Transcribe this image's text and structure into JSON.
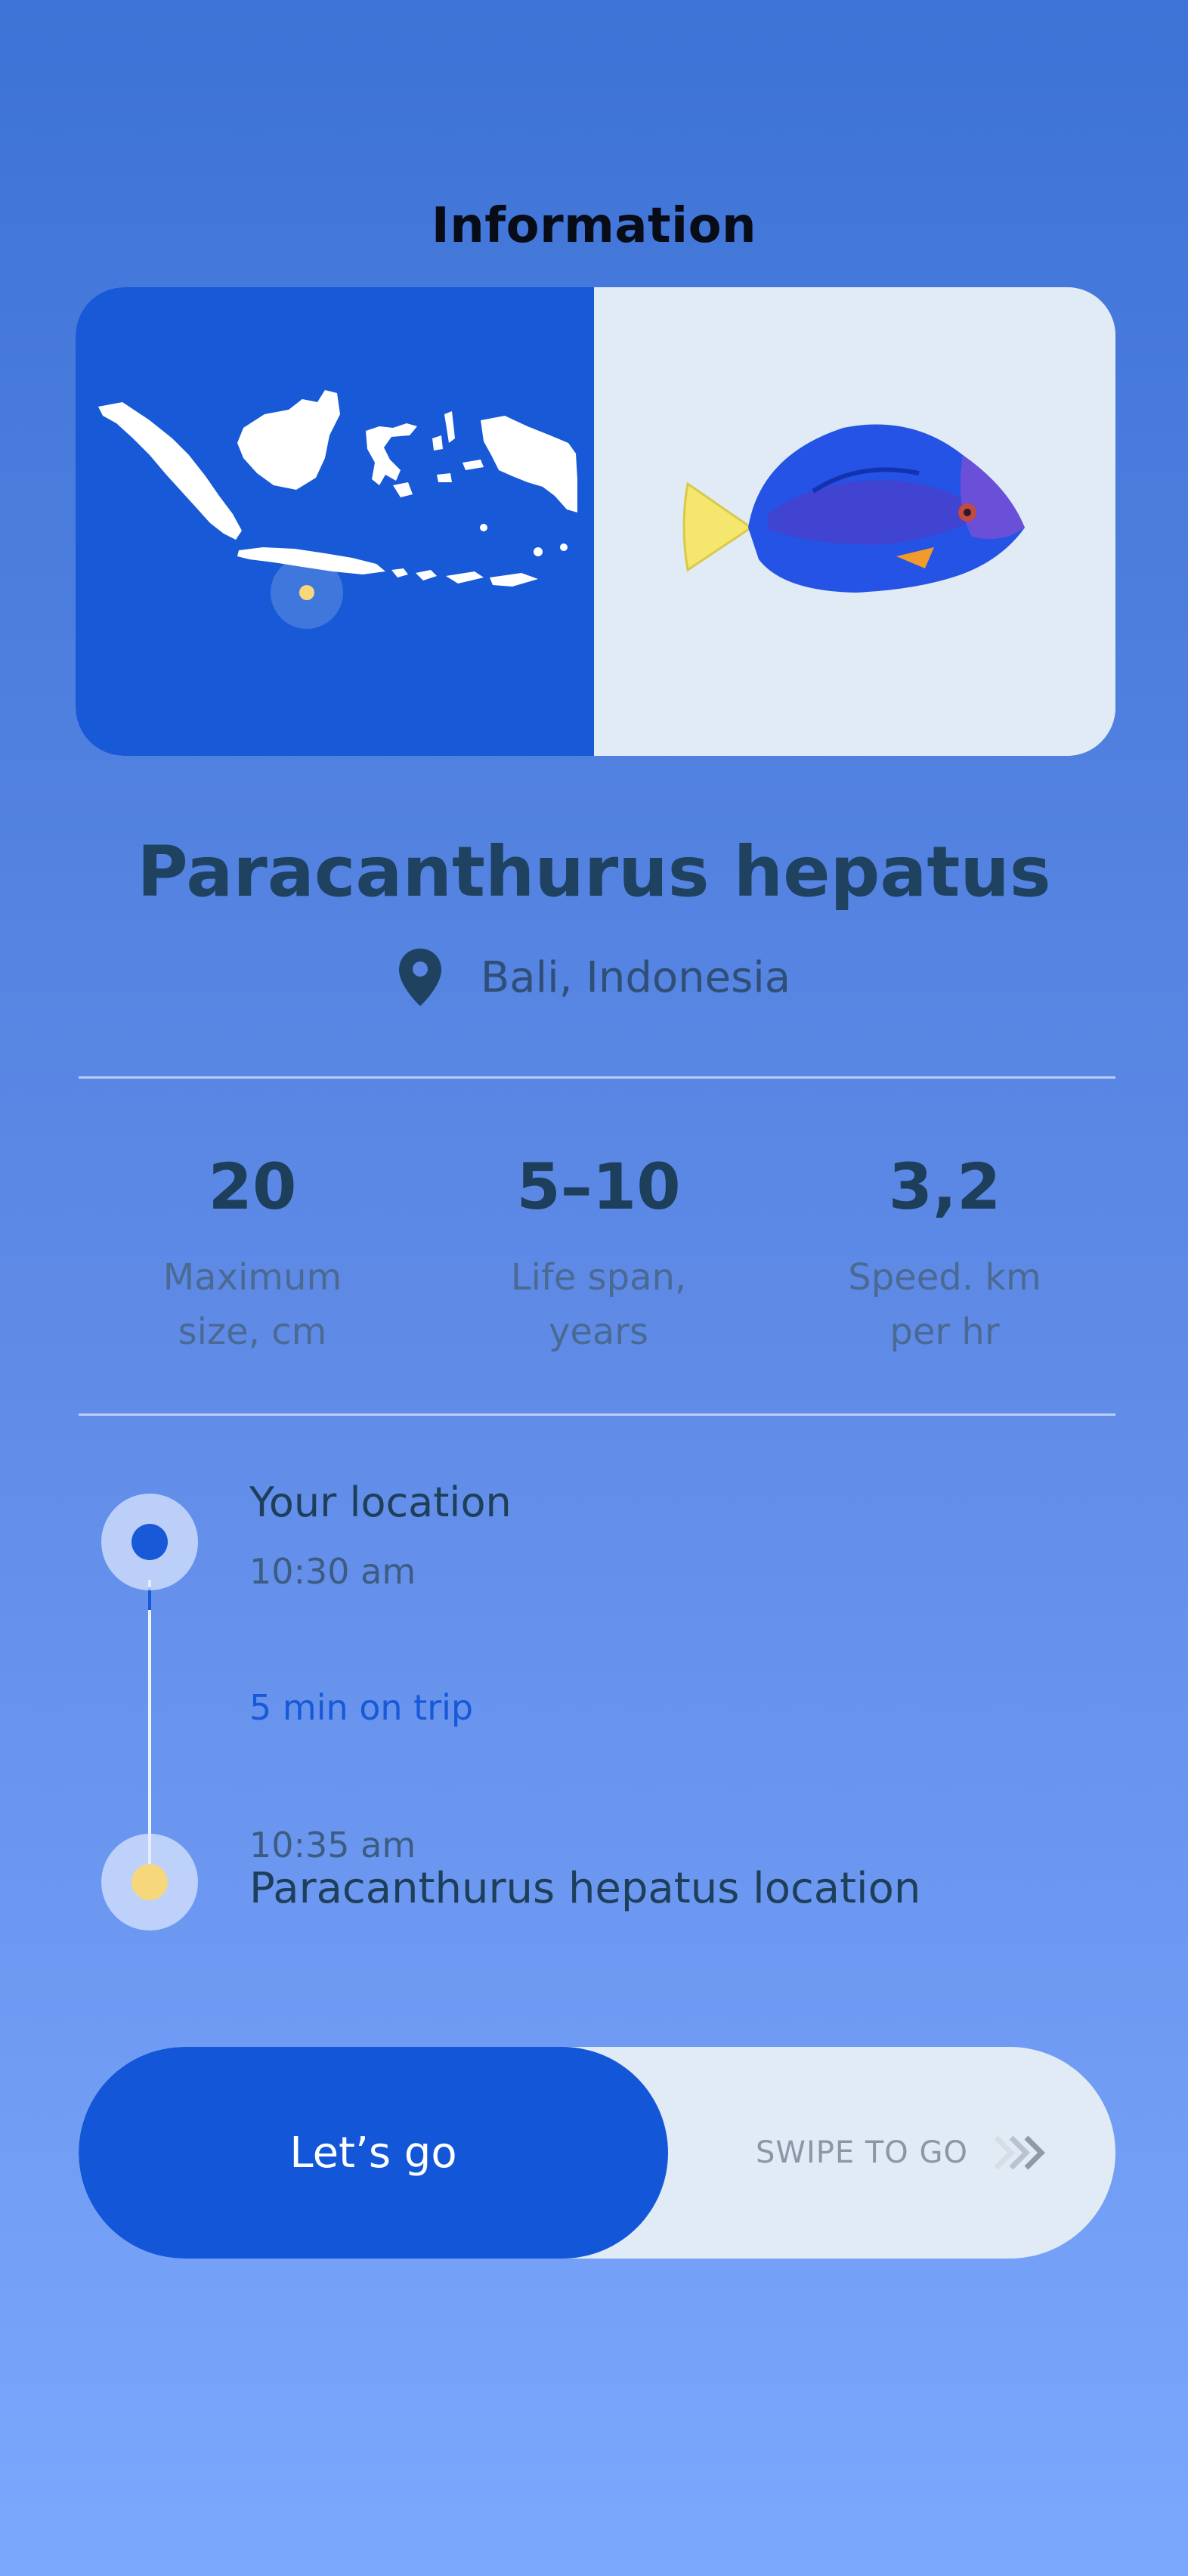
{
  "header": {
    "title": "Information"
  },
  "species": {
    "name": "Paracanthurus hepatus",
    "location": "Bali, Indonesia"
  },
  "stats": [
    {
      "value": "20",
      "label_line1": "Maximum",
      "label_line2": "size, cm"
    },
    {
      "value": "5–10",
      "label_line1": "Life span,",
      "label_line2": "years"
    },
    {
      "value": "3,2",
      "label_line1": "Speed. km",
      "label_line2": "per hr"
    }
  ],
  "route": {
    "start_label": "Your location",
    "start_time": "10:30 am",
    "duration": "5 min on trip",
    "end_time": "10:35 am",
    "end_label": "Paracanthurus hepatus location"
  },
  "action": {
    "button_label": "Let’s go",
    "swipe_hint": "SWIPE TO GO"
  },
  "colors": {
    "accent_blue": "#1759d6",
    "marker_yellow": "#f7d77c",
    "dark_text": "#1e4260"
  },
  "icons": [
    "location-pin-icon",
    "indonesia-map",
    "fish-image",
    "chevrons-right-icon"
  ]
}
